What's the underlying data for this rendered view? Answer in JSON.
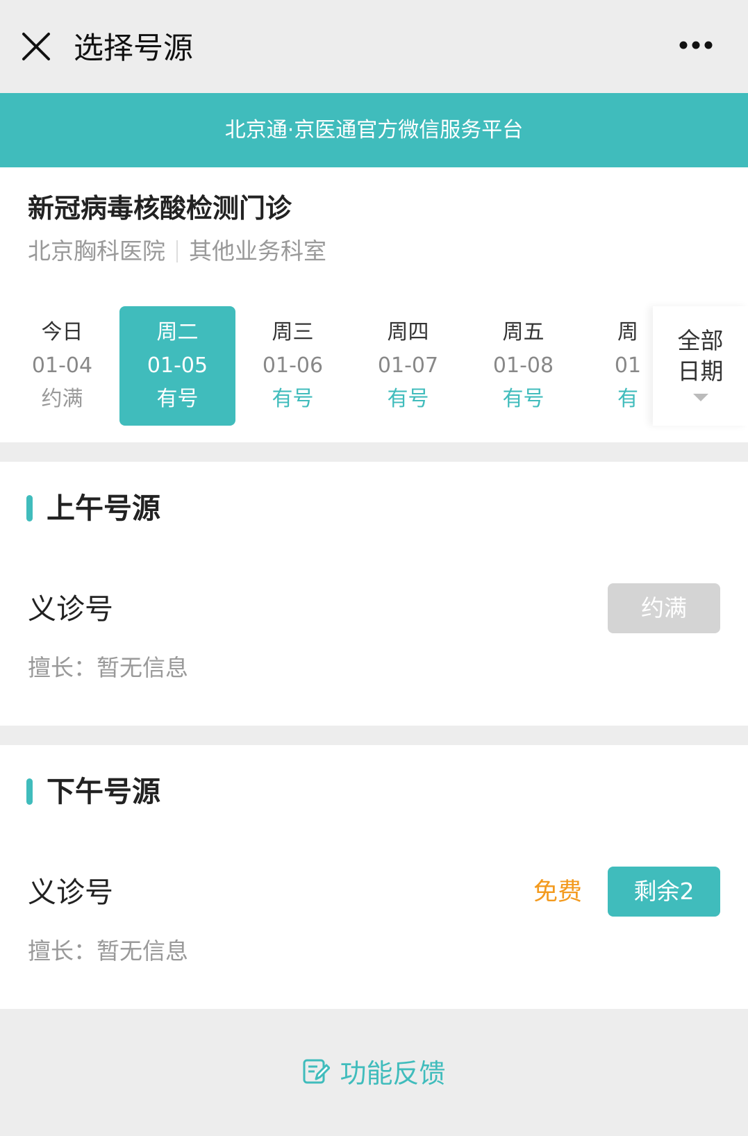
{
  "titlebar": {
    "title": "选择号源"
  },
  "banner": {
    "text": "北京通·京医通官方微信服务平台"
  },
  "clinic": {
    "name": "新冠病毒核酸检测门诊",
    "hospital": "北京胸科医院",
    "department": "其他业务科室"
  },
  "dates": [
    {
      "weekday": "今日",
      "date": "01-04",
      "status": "约满"
    },
    {
      "weekday": "周二",
      "date": "01-05",
      "status": "有号"
    },
    {
      "weekday": "周三",
      "date": "01-06",
      "status": "有号"
    },
    {
      "weekday": "周四",
      "date": "01-07",
      "status": "有号"
    },
    {
      "weekday": "周五",
      "date": "01-08",
      "status": "有号"
    },
    {
      "weekday": "周",
      "date": "01",
      "status": "有"
    }
  ],
  "all_dates": {
    "line1": "全部",
    "line2": "日期"
  },
  "morning": {
    "title": "上午号源",
    "slot_name": "义诊号",
    "slot_desc": "擅长：暂无信息",
    "button": "约满"
  },
  "afternoon": {
    "title": "下午号源",
    "slot_name": "义诊号",
    "slot_desc": "擅长：暂无信息",
    "price": "免费",
    "button": "剩余2"
  },
  "feedback": {
    "label": "功能反馈"
  },
  "colors": {
    "accent": "#40bcbc",
    "price": "#f39a1e",
    "disabled": "#d4d4d4"
  }
}
